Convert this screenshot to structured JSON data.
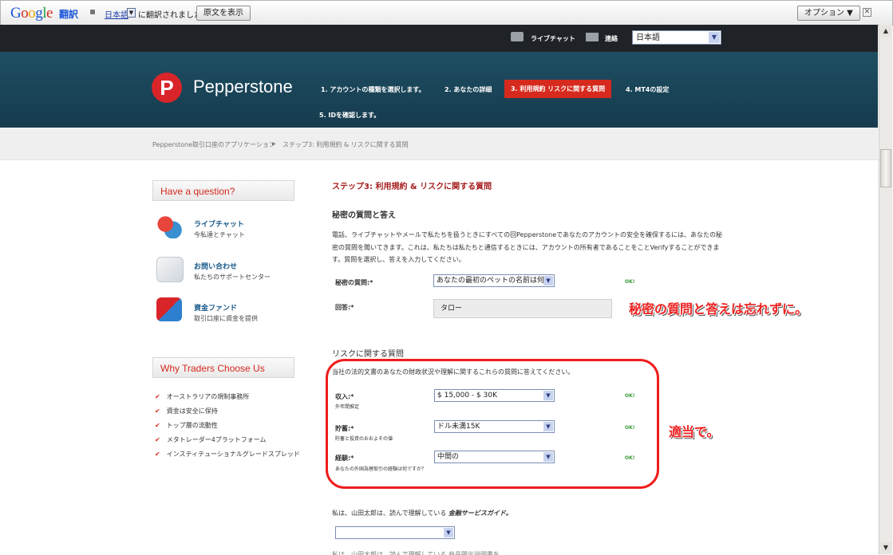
{
  "gbar": {
    "logo": "Google",
    "translate_label": "翻訳",
    "language": "日本語",
    "message": "に翻訳されました",
    "show_original_button": "原文を表示",
    "options_button": "オプション ▼",
    "close_label": "✕"
  },
  "topbar": {
    "live_chat": "ライブチャット",
    "contact": "連絡",
    "language_select": "日本語"
  },
  "header": {
    "brand": "Pepperstone",
    "steps": [
      "1. アカウントの種類を選択します。",
      "2. あなたの詳細",
      "3. 利用規約 リスクに関する質問",
      "4. MT4の設定",
      "5. IDを確認します。"
    ]
  },
  "breadcrumb": {
    "root": "Pepperstone取引口座のアプリケーション",
    "sep": "▶",
    "current": "ステップ3: 利用規約 & リスクに関する質問"
  },
  "sidebar": {
    "question_heading": "Have a question?",
    "items": [
      {
        "title": "ライブチャット",
        "sub": "今私達とチャット",
        "icon": "chat-bubbles-icon"
      },
      {
        "title": "お問い合わせ",
        "sub": "私たちのサポートセンター",
        "icon": "envelope-icon"
      },
      {
        "title": "資金ファンド",
        "sub": "取引口座に資金を提供",
        "icon": "transfer-arrows-icon"
      }
    ],
    "why_heading": "Why Traders Choose Us",
    "why_items": [
      "オーストラリアの規制事務所",
      "資金は安全に保持",
      "トップ層の流動性",
      "メタトレーダー4プラットフォーム",
      "インスティテューショナルグレードスプレッド"
    ]
  },
  "main": {
    "step_title": "ステップ3: 利用規約 & リスクに関する質問",
    "secret_heading": "秘密の質問と答え",
    "secret_paragraph_1": "電話、ライブチャットやメールで私たちを扱うときにすべての回Pepperstoneであなたのアカウントの安全を確保するには、あなたの秘",
    "secret_paragraph_2": "密の質問を聞いてきます。これは、私たちは私たちと通信するときには、アカウントの所有者であることをことVerifyすることができま",
    "secret_paragraph_3": "す。質問を選択し、答えを入力してください。",
    "secret_question_label": "秘密の質問:*",
    "secret_question_value": "あなたの最初のペットの名前は何",
    "answer_label": "回答:*",
    "answer_value": "タロー",
    "risk_heading": "リスクに関する質問",
    "risk_intro": "当社の法的文書のあなたの財政状況や理解に関するこれらの質問に答えてください。",
    "income_label": "収入:*",
    "income_sub": "外年間推定",
    "income_value": "$ 15,000 - $ 30K",
    "savings_label": "貯蓄:*",
    "savings_sub": "貯蓄と投資のおおよその値",
    "savings_value": "ドル未満15K",
    "experience_label": "経験:*",
    "experience_sub": "あなたの外国為替取引の経験は何ですか？",
    "experience_value": "中間の",
    "ok": "OK!",
    "agree_text": "私は、山田太郎は、読んで理解している",
    "agree_link": "金融サービスガイド。",
    "agree_select": "",
    "bottom_partial": "私は、山田太郎は、読んで理解している 商品開示説明書を"
  },
  "annotations": {
    "note1": "秘密の質問と答えは忘れずに。",
    "note2": "適当で。"
  }
}
